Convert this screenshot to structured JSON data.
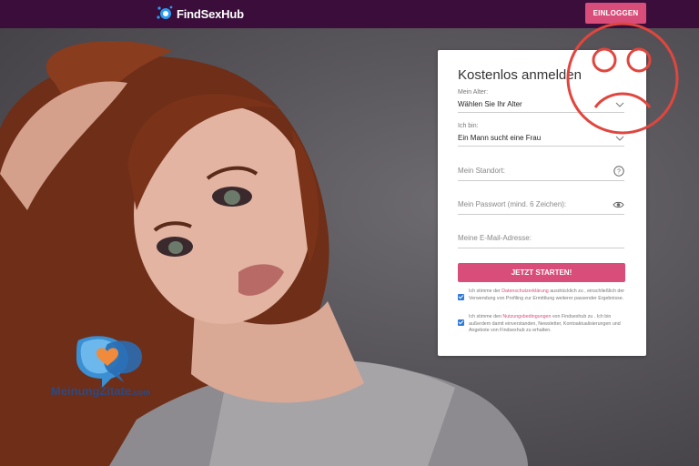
{
  "header": {
    "brand": "FindSexHub",
    "login_label": "EINLOGGEN"
  },
  "form": {
    "title": "Kostenlos anmelden",
    "age_label": "Mein Alter:",
    "age_value": "Wählen Sie Ihr Alter",
    "iam_label": "Ich bin:",
    "iam_value": "Ein Mann sucht eine Frau",
    "location_placeholder": "Mein Standort:",
    "password_placeholder": "Mein Passwort (mind. 6 Zeichen):",
    "email_placeholder": "Meine E-Mail-Adresse:",
    "submit_label": "JETZT STARTEN!",
    "consent1_pre": "Ich stimme der ",
    "consent1_link": "Datenschutzerklärung",
    "consent1_post": " ausdrücklich zu , einschließlich der Verwendung von Profiling zur Ermittlung weiterer passender Ergebnisse.",
    "consent2_pre": "Ich stimme den ",
    "consent2_link": "Nutzungsbedingungen",
    "consent2_post": " von Findsexhub zu . Ich bin außerdem damit einverstanden, Newsletter, Kontoaktualisierungen und Angebote von Findsexhub zu erhalten."
  },
  "watermark": {
    "name": "MeinungZitate",
    "suffix": ".com"
  },
  "colors": {
    "header_bg": "#3a0d3a",
    "accent": "#d94d7a",
    "overlay": "#e0463e"
  },
  "icons": [
    "logo-mark-icon",
    "chevron-down-icon",
    "help-icon",
    "eye-icon",
    "checkbox-icon",
    "speech-heart-icon",
    "sad-face-icon"
  ]
}
